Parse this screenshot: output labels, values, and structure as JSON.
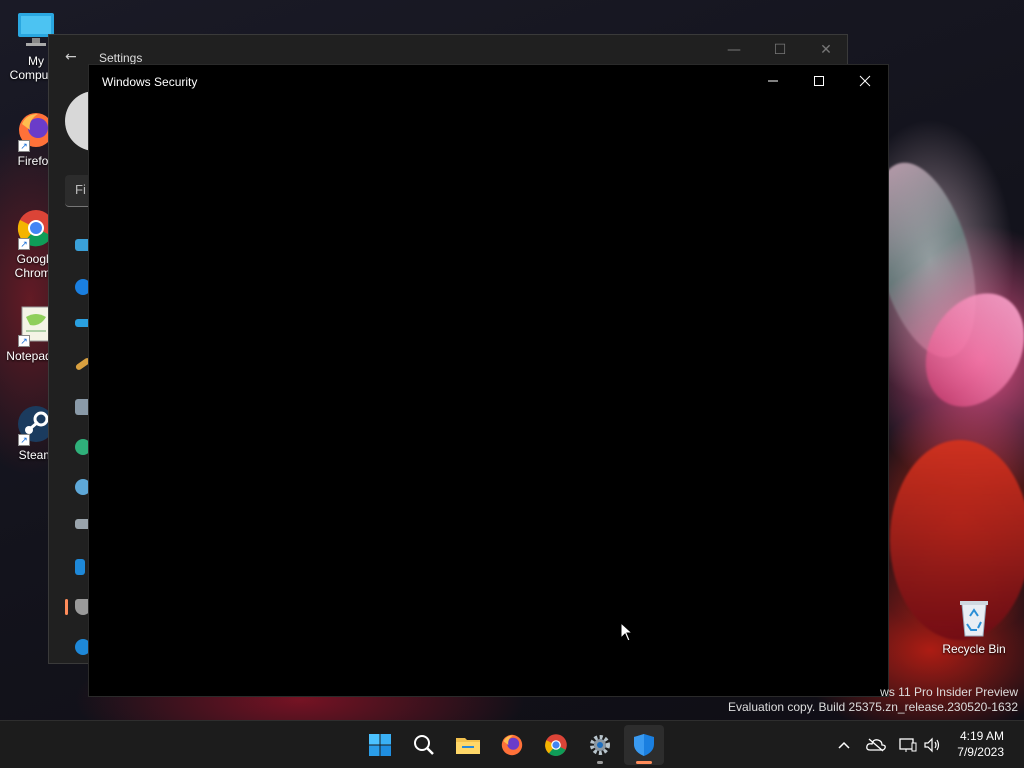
{
  "desktop": {
    "icons": [
      {
        "label": "My Computer",
        "icon": "monitor-icon"
      },
      {
        "label": "Firefox",
        "icon": "firefox-icon"
      },
      {
        "label": "Google Chrome",
        "icon": "chrome-icon"
      },
      {
        "label": "Notepad++",
        "icon": "notepad-icon"
      },
      {
        "label": "Steam",
        "icon": "steam-icon"
      },
      {
        "label": "Recycle Bin",
        "icon": "recycle-bin-icon"
      }
    ],
    "watermark_line1": "ws 11 Pro Insider Preview",
    "watermark_line2": "Evaluation copy. Build 25375.zn_release.230520-1632"
  },
  "settings_window": {
    "title": "Settings",
    "search_placeholder": "Fi",
    "controls": {
      "minimize": "—",
      "maximize": "☐",
      "close": "✕"
    }
  },
  "security_window": {
    "title": "Windows Security",
    "controls": {
      "minimize": "—",
      "maximize": "☐",
      "close": "✕"
    }
  },
  "taskbar": {
    "apps": [
      {
        "name": "start-button",
        "icon": "windows-logo-icon"
      },
      {
        "name": "search-button",
        "icon": "search-icon"
      },
      {
        "name": "file-explorer",
        "icon": "folder-icon"
      },
      {
        "name": "firefox",
        "icon": "firefox-icon"
      },
      {
        "name": "chrome",
        "icon": "chrome-icon"
      },
      {
        "name": "settings",
        "icon": "gear-icon"
      },
      {
        "name": "windows-security",
        "icon": "shield-icon"
      }
    ],
    "clock_time": "4:19 AM",
    "clock_date": "7/9/2023"
  },
  "colors": {
    "accent": "#ff8c5a",
    "security_blue": "#1a7fe0",
    "taskbar_bg": "#1c1c1c"
  }
}
